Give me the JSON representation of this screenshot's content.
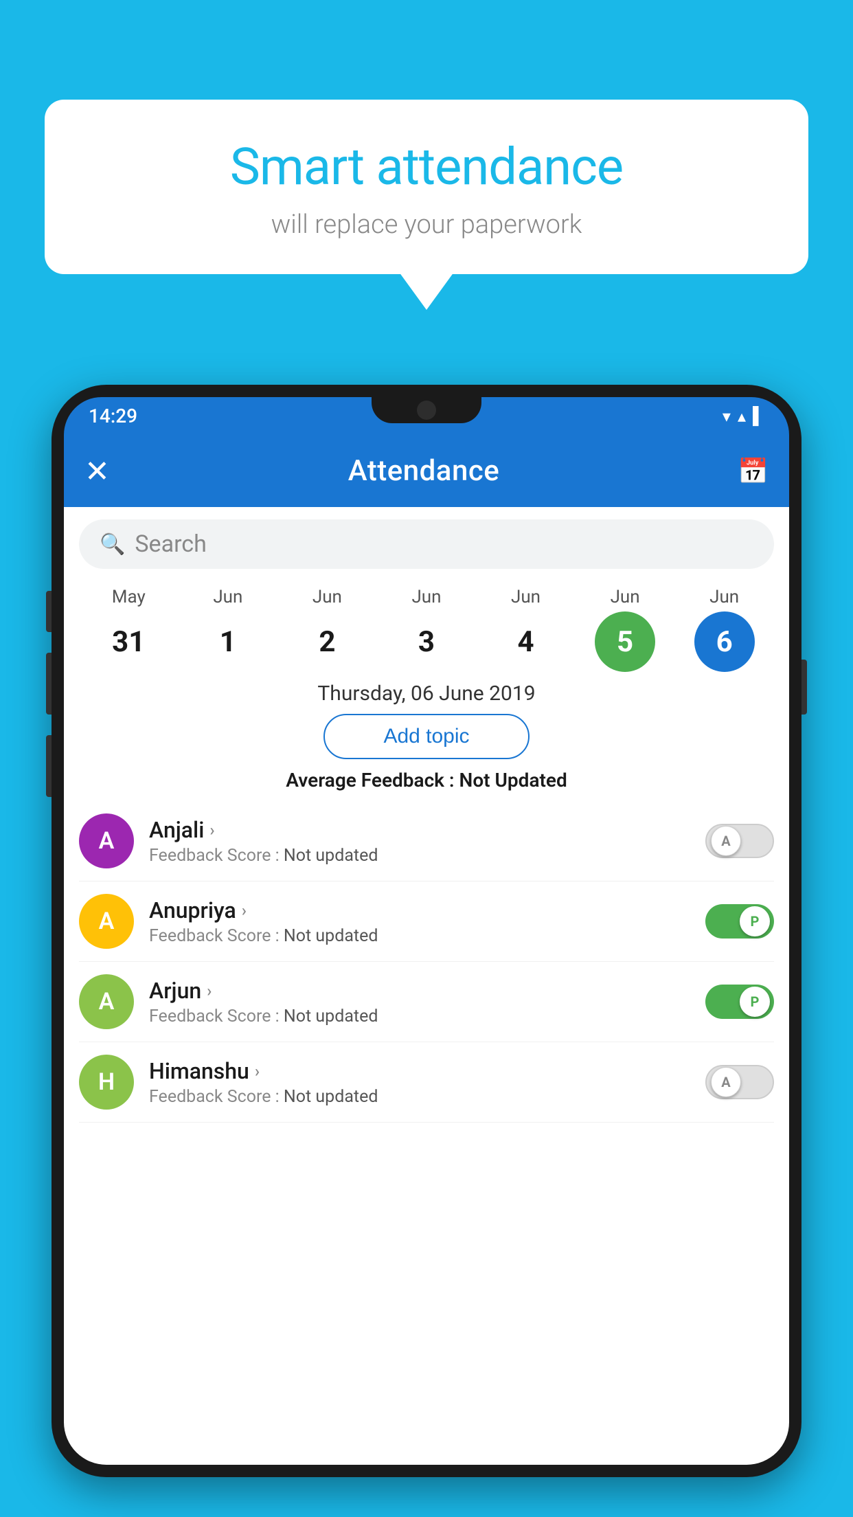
{
  "background_color": "#1ab8e8",
  "speech_bubble": {
    "title": "Smart attendance",
    "subtitle": "will replace your paperwork"
  },
  "status_bar": {
    "time": "14:29",
    "wifi": "▼",
    "signal": "▲",
    "battery": "▌"
  },
  "app_bar": {
    "title": "Attendance",
    "close_label": "×",
    "calendar_icon": "calendar-icon"
  },
  "search": {
    "placeholder": "Search"
  },
  "calendar": {
    "days": [
      {
        "month": "May",
        "date": "31",
        "style": "normal"
      },
      {
        "month": "Jun",
        "date": "1",
        "style": "normal"
      },
      {
        "month": "Jun",
        "date": "2",
        "style": "normal"
      },
      {
        "month": "Jun",
        "date": "3",
        "style": "normal"
      },
      {
        "month": "Jun",
        "date": "4",
        "style": "normal"
      },
      {
        "month": "Jun",
        "date": "5",
        "style": "today"
      },
      {
        "month": "Jun",
        "date": "6",
        "style": "selected"
      }
    ],
    "selected_date_label": "Thursday, 06 June 2019"
  },
  "add_topic_button": "Add topic",
  "average_feedback": {
    "label": "Average Feedback : ",
    "value": "Not Updated"
  },
  "students": [
    {
      "name": "Anjali",
      "avatar_letter": "A",
      "avatar_color": "#9c27b0",
      "feedback": "Feedback Score : ",
      "feedback_value": "Not updated",
      "attendance": "absent"
    },
    {
      "name": "Anupriya",
      "avatar_letter": "A",
      "avatar_color": "#ffc107",
      "feedback": "Feedback Score : ",
      "feedback_value": "Not updated",
      "attendance": "present"
    },
    {
      "name": "Arjun",
      "avatar_letter": "A",
      "avatar_color": "#8bc34a",
      "feedback": "Feedback Score : ",
      "feedback_value": "Not updated",
      "attendance": "present"
    },
    {
      "name": "Himanshu",
      "avatar_letter": "H",
      "avatar_color": "#8bc34a",
      "feedback": "Feedback Score : ",
      "feedback_value": "Not updated",
      "attendance": "absent"
    }
  ]
}
